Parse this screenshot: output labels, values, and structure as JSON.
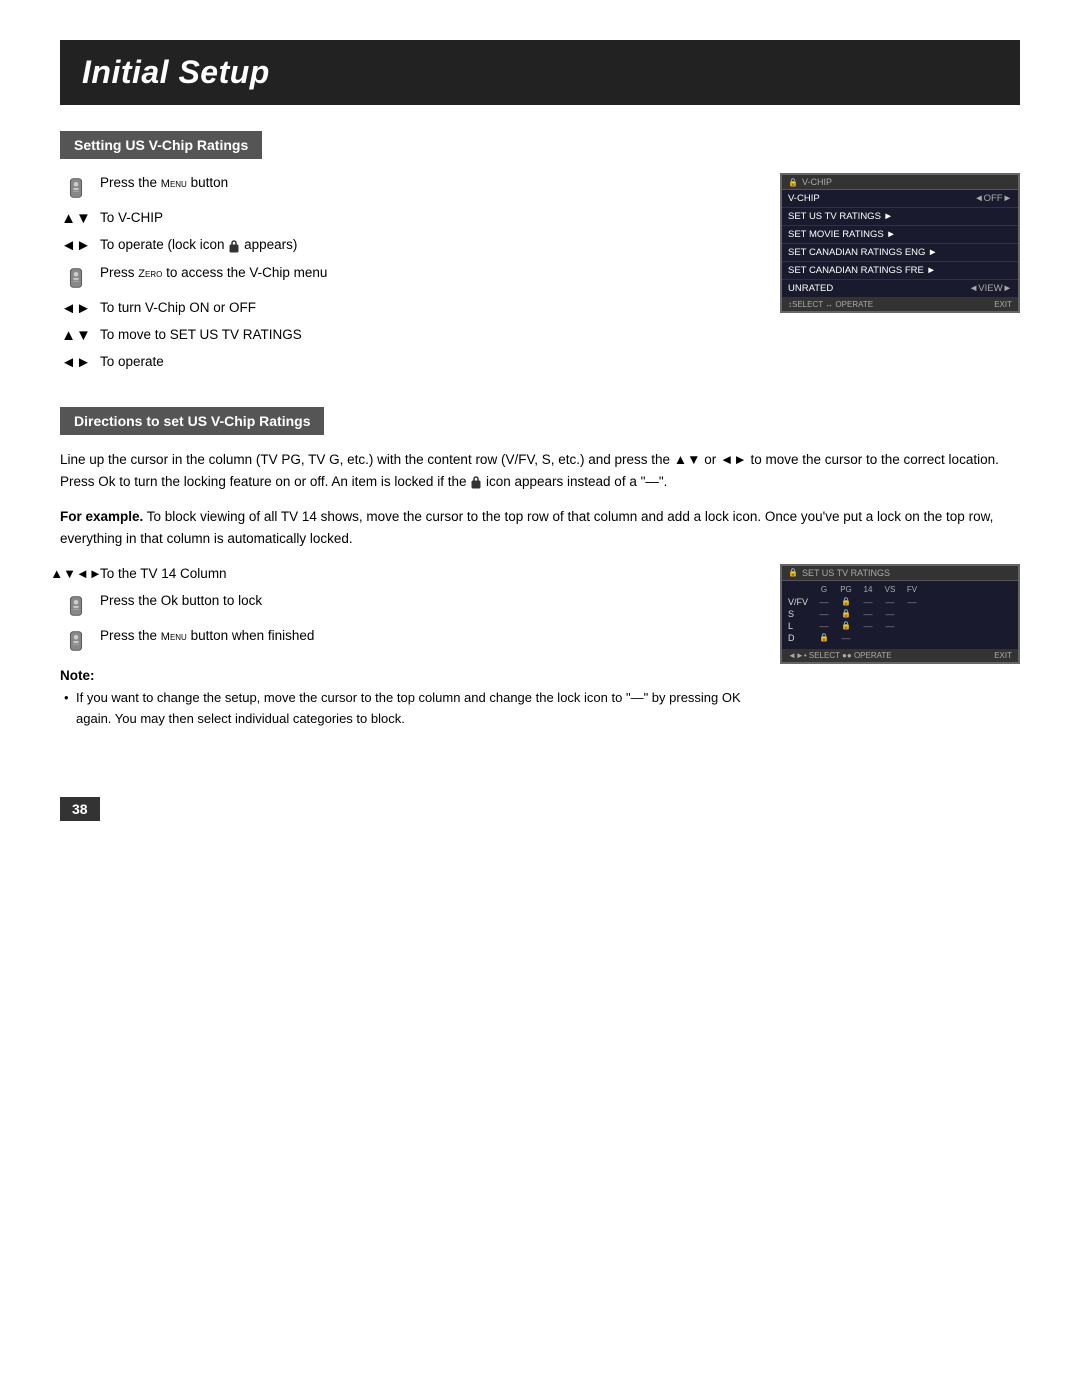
{
  "page": {
    "title": "Initial Setup",
    "page_number": "38"
  },
  "section1": {
    "header": "Setting US V-Chip Ratings",
    "instructions": [
      {
        "icon": "remote",
        "text": "Press the MENU button"
      },
      {
        "icon": "arrows-ud",
        "text": "To V-CHIP"
      },
      {
        "icon": "arrows-lr",
        "text": "To operate (lock icon appears)"
      },
      {
        "icon": "remote",
        "text": "Press ZERO to access the V-Chip menu"
      },
      {
        "icon": "arrows-lr",
        "text": "To turn V-Chip ON or OFF"
      },
      {
        "icon": "arrows-ud",
        "text": "To move to SET US TV RATINGS"
      },
      {
        "icon": "arrows-lr",
        "text": "To operate"
      }
    ],
    "screen": {
      "title": "V-CHIP",
      "items": [
        {
          "label": "V-CHIP",
          "value": "◄OFF►",
          "selected": false
        },
        {
          "label": "SET US TV RATINGS ►",
          "value": "",
          "selected": false
        },
        {
          "label": "SET MOVIE RATINGS ►",
          "value": "",
          "selected": false
        },
        {
          "label": "SET CANADIAN RATINGS ENG ►",
          "value": "",
          "selected": false
        },
        {
          "label": "SET CANADIAN RATINGS FRE ►",
          "value": "",
          "selected": false
        },
        {
          "label": "UNRATED",
          "value": "◄VIEW►",
          "selected": false
        }
      ],
      "footer_left": "↕SELECT ↔ OPERATE",
      "footer_right": "EXIT"
    }
  },
  "section2": {
    "header": "Directions to set US V-Chip Ratings",
    "description": "Line up the cursor in the column (TV PG, TV G, etc.) with the content row (V/FV, S, etc.) and press the ▲▼ or ◄► to move the cursor to the correct location. Press OK to turn the locking feature on or off. An item is locked if the 🔒 icon appears instead of a \"—\".",
    "example": "For example. To block viewing of all TV 14 shows, move the cursor to the top row of that column and add a lock icon. Once you've put a lock on the top row, everything in that column is automatically locked.",
    "instructions": [
      {
        "icon": "arrows-all",
        "text": "To the TV 14 Column"
      },
      {
        "icon": "remote",
        "text": "Press the OK button to lock"
      },
      {
        "icon": "remote",
        "text": "Press the MENU button when finished"
      }
    ],
    "note": {
      "label": "Note:",
      "text": "If you want to change the setup, move the cursor to the top column and change the lock icon to \"—\" by pressing OK again. You may then select individual categories to block."
    },
    "screen": {
      "title": "SET US TV RATINGS",
      "columns": [
        "G",
        "PG",
        "14",
        "VS",
        "FV"
      ],
      "rows": [
        {
          "label": "V/FV",
          "cells": [
            "—",
            "🔒",
            "—",
            "—",
            "—",
            "—"
          ]
        },
        {
          "label": "S",
          "cells": [
            "—",
            "🔒",
            "—",
            "—"
          ]
        },
        {
          "label": "L",
          "cells": [
            "—",
            "🔒",
            "—",
            "—"
          ]
        },
        {
          "label": "D",
          "cells": [
            "🔒",
            "—"
          ]
        }
      ],
      "footer_left": "◄►• SELECT ●● OPERATE",
      "footer_right": "EXIT"
    }
  }
}
